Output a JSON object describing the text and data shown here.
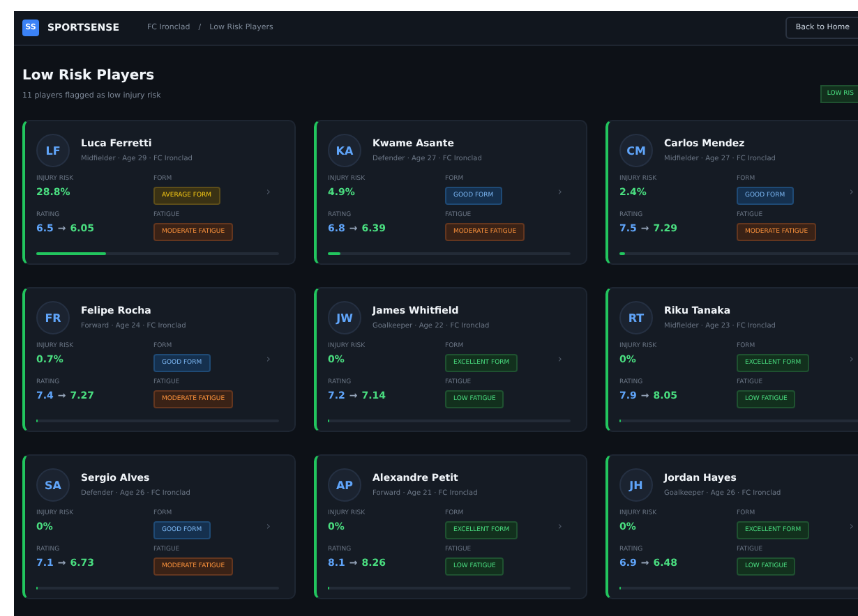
{
  "header": {
    "logo": "SS",
    "brand": "SPORTSENSE",
    "breadcrumb": [
      "FC Ironclad",
      "Low Risk Players"
    ],
    "separator": "/",
    "back_button": "Back to Home"
  },
  "page": {
    "title": "Low Risk Players",
    "subtitle": "11 players flagged as low injury risk",
    "badge": "LOW RIS"
  },
  "players": [
    {
      "initials": "LF",
      "name": "Luca Ferretti",
      "meta": "Midfielder · Age 29 · FC Ironclad",
      "risk_label": "INJURY RISK",
      "risk": "28.8%",
      "form_label": "FORM",
      "form": {
        "kind": "average",
        "label": "AVERAGE FORM"
      },
      "rating_label": "RATING",
      "rating_from": "6.5",
      "arrow": "→",
      "rating_to": "6.05",
      "fatigue_label": "FATIGUE",
      "fatigue": {
        "kind": "moderate",
        "label": "MODERATE FATIGUE"
      },
      "chevron": "›",
      "level": 0.29
    },
    {
      "initials": "KA",
      "name": "Kwame Asante",
      "meta": "Defender · Age 27 · FC Ironclad",
      "risk_label": "INJURY RISK",
      "risk": "4.9%",
      "form_label": "FORM",
      "form": {
        "kind": "good",
        "label": "GOOD FORM"
      },
      "rating_label": "RATING",
      "rating_from": "6.8",
      "arrow": "→",
      "rating_to": "6.39",
      "fatigue_label": "FATIGUE",
      "fatigue": {
        "kind": "moderate",
        "label": "MODERATE FATIGUE"
      },
      "chevron": "›",
      "level": 0.05
    },
    {
      "initials": "CM",
      "name": "Carlos Mendez",
      "meta": "Midfielder · Age 27 · FC Ironclad",
      "risk_label": "INJURY RISK",
      "risk": "2.4%",
      "form_label": "FORM",
      "form": {
        "kind": "good",
        "label": "GOOD FORM"
      },
      "rating_label": "RATING",
      "rating_from": "7.5",
      "arrow": "→",
      "rating_to": "7.29",
      "fatigue_label": "FATIGUE",
      "fatigue": {
        "kind": "moderate",
        "label": "MODERATE FATIGUE"
      },
      "chevron": "›",
      "level": 0.024
    },
    {
      "initials": "FR",
      "name": "Felipe Rocha",
      "meta": "Forward · Age 24 · FC Ironclad",
      "risk_label": "INJURY RISK",
      "risk": "0.7%",
      "form_label": "FORM",
      "form": {
        "kind": "good",
        "label": "GOOD FORM"
      },
      "rating_label": "RATING",
      "rating_from": "7.4",
      "arrow": "→",
      "rating_to": "7.27",
      "fatigue_label": "FATIGUE",
      "fatigue": {
        "kind": "moderate",
        "label": "MODERATE FATIGUE"
      },
      "chevron": "›",
      "level": 0.007
    },
    {
      "initials": "JW",
      "name": "James Whitfield",
      "meta": "Goalkeeper · Age 22 · FC Ironclad",
      "risk_label": "INJURY RISK",
      "risk": "0%",
      "form_label": "FORM",
      "form": {
        "kind": "excellent",
        "label": "EXCELLENT FORM"
      },
      "rating_label": "RATING",
      "rating_from": "7.2",
      "arrow": "→",
      "rating_to": "7.14",
      "fatigue_label": "FATIGUE",
      "fatigue": {
        "kind": "low",
        "label": "LOW FATIGUE"
      },
      "chevron": "›",
      "level": 0
    },
    {
      "initials": "RT",
      "name": "Riku Tanaka",
      "meta": "Midfielder · Age 23 · FC Ironclad",
      "risk_label": "INJURY RISK",
      "risk": "0%",
      "form_label": "FORM",
      "form": {
        "kind": "excellent",
        "label": "EXCELLENT FORM"
      },
      "rating_label": "RATING",
      "rating_from": "7.9",
      "arrow": "→",
      "rating_to": "8.05",
      "fatigue_label": "FATIGUE",
      "fatigue": {
        "kind": "low",
        "label": "LOW FATIGUE"
      },
      "chevron": "›",
      "level": 0
    },
    {
      "initials": "SA",
      "name": "Sergio Alves",
      "meta": "Defender · Age 26 · FC Ironclad",
      "risk_label": "INJURY RISK",
      "risk": "0%",
      "form_label": "FORM",
      "form": {
        "kind": "good",
        "label": "GOOD FORM"
      },
      "rating_label": "RATING",
      "rating_from": "7.1",
      "arrow": "→",
      "rating_to": "6.73",
      "fatigue_label": "FATIGUE",
      "fatigue": {
        "kind": "moderate",
        "label": "MODERATE FATIGUE"
      },
      "chevron": "›",
      "level": 0
    },
    {
      "initials": "AP",
      "name": "Alexandre Petit",
      "meta": "Forward · Age 21 · FC Ironclad",
      "risk_label": "INJURY RISK",
      "risk": "0%",
      "form_label": "FORM",
      "form": {
        "kind": "excellent",
        "label": "EXCELLENT FORM"
      },
      "rating_label": "RATING",
      "rating_from": "8.1",
      "arrow": "→",
      "rating_to": "8.26",
      "fatigue_label": "FATIGUE",
      "fatigue": {
        "kind": "low",
        "label": "LOW FATIGUE"
      },
      "chevron": "›",
      "level": 0
    },
    {
      "initials": "JH",
      "name": "Jordan Hayes",
      "meta": "Goalkeeper · Age 26 · FC Ironclad",
      "risk_label": "INJURY RISK",
      "risk": "0%",
      "form_label": "FORM",
      "form": {
        "kind": "excellent",
        "label": "EXCELLENT FORM"
      },
      "rating_label": "RATING",
      "rating_from": "6.9",
      "arrow": "→",
      "rating_to": "6.48",
      "fatigue_label": "FATIGUE",
      "fatigue": {
        "kind": "low",
        "label": "LOW FATIGUE"
      },
      "chevron": "›",
      "level": 0
    }
  ]
}
